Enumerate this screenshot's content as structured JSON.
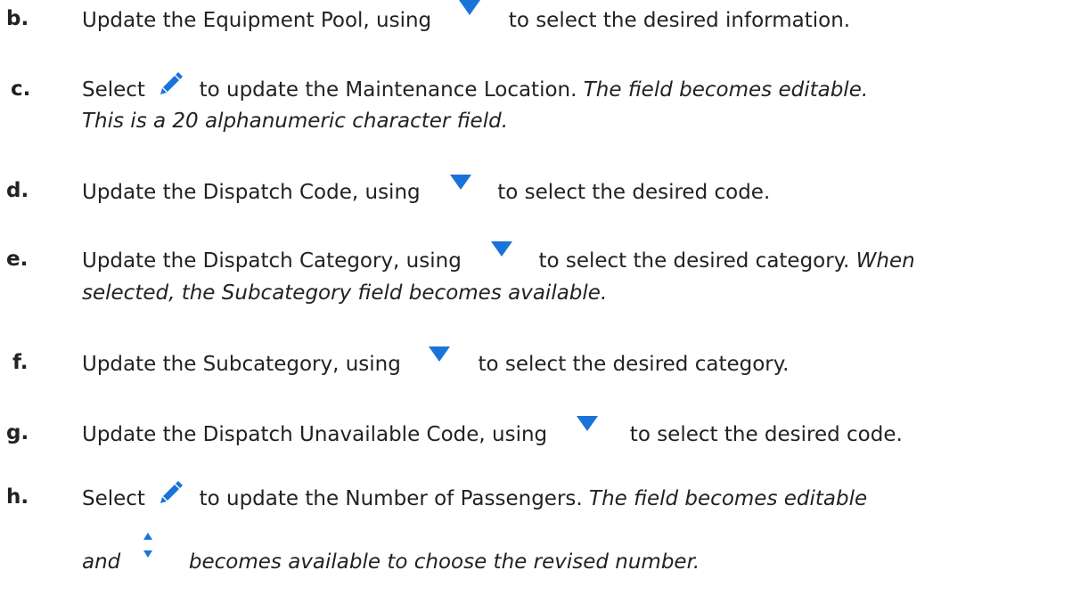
{
  "steps": [
    {
      "letter": "b.",
      "before": "Update the Equipment Pool, using",
      "icon": "dropdown-arrow-icon",
      "after": "to select the desired information."
    },
    {
      "letter": "c.",
      "before": "Select",
      "icon": "pencil-edit-icon",
      "after": "to update the Maintenance Location.",
      "italic_line1": "The field becomes editable.",
      "italic_line2": "This is a 20 alphanumeric character field."
    },
    {
      "letter": "d.",
      "before": "Update the Dispatch Code, using",
      "icon": "dropdown-arrow-icon",
      "after": "to select the desired code."
    },
    {
      "letter": "e.",
      "before": "Update the Dispatch Category, using",
      "icon": "dropdown-arrow-icon",
      "after": "to select the desired category.",
      "italic_line1": "When",
      "italic_line2": "selected, the Subcategory field becomes available."
    },
    {
      "letter": "f.",
      "before": "Update the  Subcategory, using",
      "icon": "dropdown-arrow-icon",
      "after": "to select the desired category."
    },
    {
      "letter": "g.",
      "before": "Update the Dispatch Unavailable Code, using",
      "icon": "dropdown-arrow-icon",
      "after": "to select the desired code."
    },
    {
      "letter": "h.",
      "before": "Select",
      "icon": "pencil-edit-icon",
      "after": "to update the Number of Passengers.",
      "italic_line1": "The field becomes editable",
      "italic_line2_pre": "and",
      "icon2": "stepper-arrows-icon",
      "italic_line2": "becomes available to choose the revised number."
    }
  ],
  "colors": {
    "icon_blue": "#1a73d9",
    "text": "#222222"
  }
}
